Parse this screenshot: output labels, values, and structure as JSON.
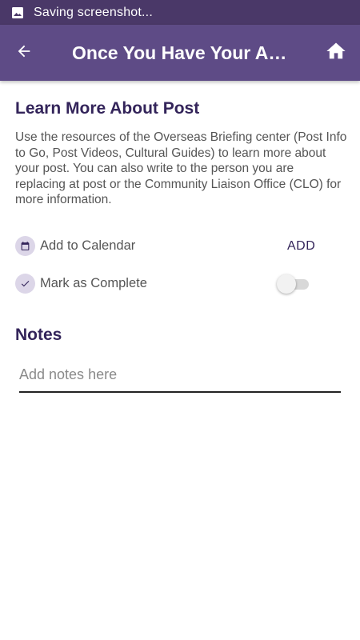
{
  "status_bar": {
    "text": "Saving screenshot..."
  },
  "app_bar": {
    "title": "Once You Have Your Assignment"
  },
  "section": {
    "title": "Learn More About Post",
    "description": "Use the resources of the Overseas Briefing center (Post Info to Go, Post Videos, Cultural Guides) to learn more about your post. You can also write to the person you are replacing at post or the Community Liaison Office (CLO) for more information."
  },
  "actions": {
    "calendar_label": "Add to Calendar",
    "calendar_button": "ADD",
    "complete_label": "Mark as Complete",
    "complete_on": false
  },
  "notes": {
    "title": "Notes",
    "placeholder": "Add notes here"
  },
  "colors": {
    "status_bar": "#4a3868",
    "app_bar": "#5e4b86",
    "heading": "#33245a",
    "icon_bg": "#dcd6e8"
  }
}
